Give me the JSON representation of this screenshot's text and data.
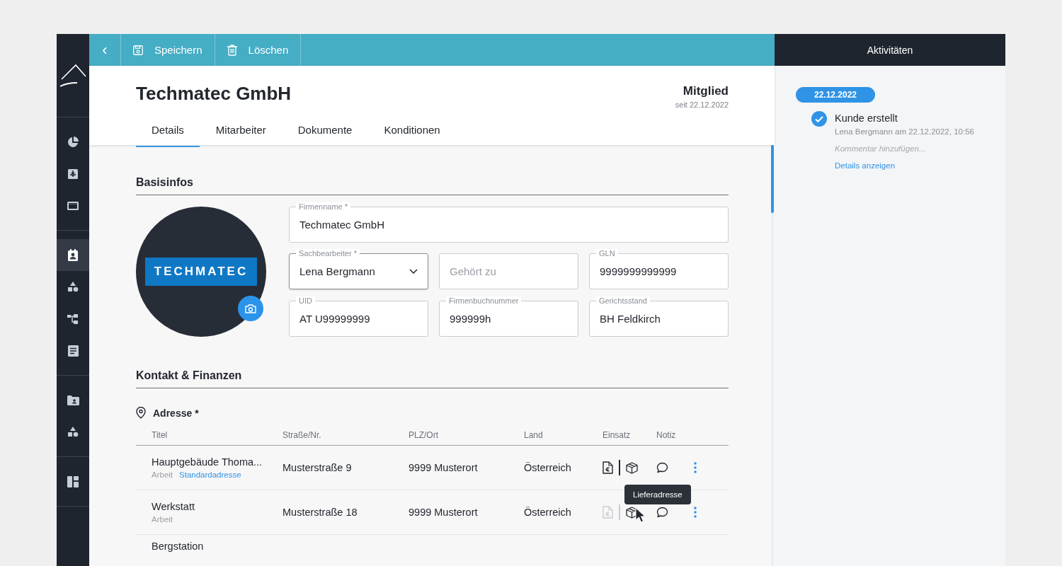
{
  "toolbar": {
    "buttons": [
      {
        "kind": "back",
        "label": "‹"
      },
      {
        "kind": "save",
        "label": "Speichern"
      },
      {
        "kind": "delete",
        "label": "Löschen"
      }
    ]
  },
  "sidebar": {
    "groups": [
      [
        {
          "selected": false
        },
        {
          "selected": false
        },
        {
          "selected": false
        }
      ],
      [
        {
          "selected": true
        },
        {
          "selected": false
        },
        {
          "selected": false
        },
        {
          "selected": false
        }
      ],
      [
        {
          "selected": false
        },
        {
          "selected": false
        }
      ],
      [
        {
          "selected": false
        }
      ]
    ]
  },
  "header": {
    "title": "Techmatec GmbH",
    "status": "Mitglied",
    "since": "seit 22.12.2022"
  },
  "tabs": [
    {
      "label": "Details",
      "selected": true
    },
    {
      "label": "Mitarbeiter",
      "selected": false
    },
    {
      "label": "Dokumente",
      "selected": false
    },
    {
      "label": "Konditionen",
      "selected": false
    }
  ],
  "basisinfos": {
    "heading": "Basisinfos",
    "logo_text": "TECHMATEC",
    "fields": [
      {
        "kind": "text",
        "label": "Firmenname *",
        "value": "Techmatec GmbH"
      },
      {
        "kind": "select",
        "label": "Sachbearbeiter *",
        "value": "Lena Bergmann"
      },
      {
        "kind": "text",
        "placeholder": "Gehört zu"
      },
      {
        "kind": "text",
        "label": "GLN",
        "value": "9999999999999"
      },
      {
        "kind": "text",
        "label": "UID",
        "value": "AT U99999999"
      },
      {
        "kind": "text",
        "label": "Firmenbuchnummer",
        "value": "999999h"
      },
      {
        "kind": "text",
        "label": "Gerichtsstand",
        "value": "BH Feldkirch"
      }
    ]
  },
  "kontakt": {
    "heading": "Kontakt & Finanzen",
    "address_heading": "Adresse *",
    "columns": [
      "Titel",
      "Straße/Nr.",
      "PLZ/Ort",
      "Land",
      "Einsatz",
      "Notiz"
    ],
    "rows": [
      {
        "title": "Hauptgebäude Thoma...",
        "type": "Arbeit",
        "tag": "Standardadresse",
        "street": "Musterstraße 9",
        "city": "9999 Musterort",
        "country": "Österreich",
        "invoice": true,
        "delivery": true
      },
      {
        "title": "Werkstatt",
        "type": "Arbeit",
        "street": "Musterstraße 18",
        "city": "9999 Musterort",
        "country": "Österreich",
        "invoice": false,
        "delivery": true,
        "tooltip": "Lieferadresse"
      },
      {
        "title": "Bergstation"
      }
    ]
  },
  "activities": {
    "title": "Aktivitäten",
    "date": "22.12.2022",
    "entries": [
      {
        "done": true,
        "title": "Kunde erstellt",
        "meta": "Lena Bergmann am 22.12.2022, 10:56",
        "comment_placeholder": "Kommentar hinzufügen...",
        "link": "Details anzeigen"
      }
    ]
  }
}
